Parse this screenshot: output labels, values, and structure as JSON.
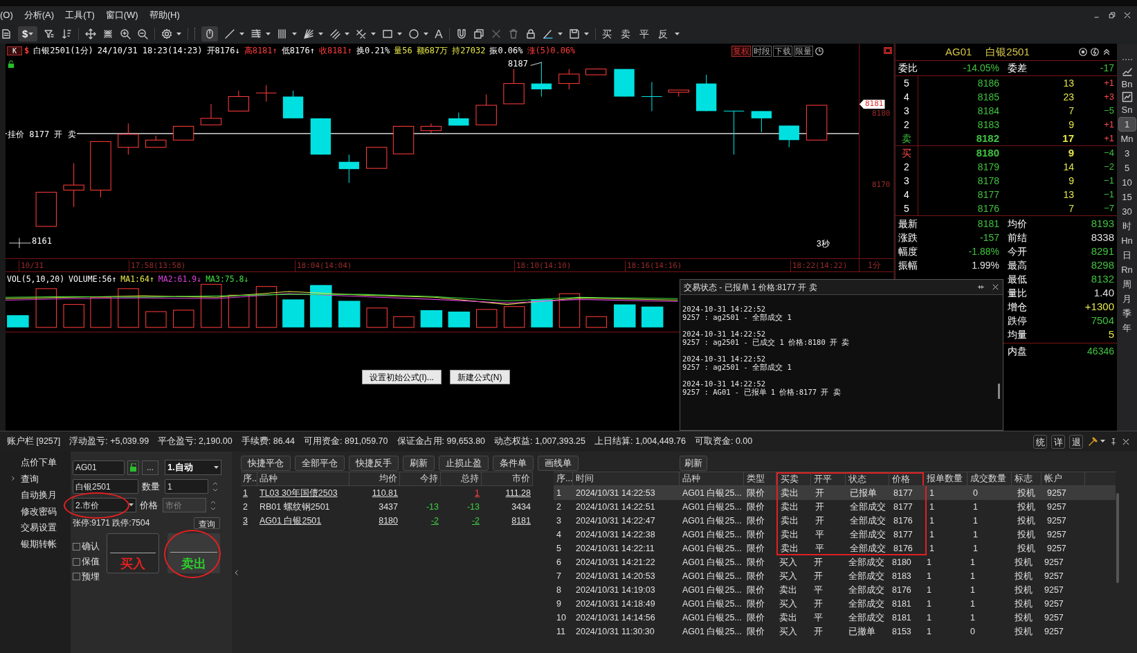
{
  "menu": [
    "(O)",
    "分析(A)",
    "工具(T)",
    "窗口(W)",
    "帮助(H)"
  ],
  "toolbar": {
    "currency": "$",
    "text_tool": "A",
    "trade_buttons": [
      "买",
      "卖",
      "平",
      "反"
    ]
  },
  "chart": {
    "badge": "K",
    "currency_mark": "$",
    "header": [
      {
        "text": "白银2501(1分)",
        "color": "#ffffff"
      },
      {
        "text": "24/10/31 18:23(14:23)",
        "color": "#ffffff"
      },
      {
        "text": "开8176↓",
        "color": "#ffffff"
      },
      {
        "text": "高8181↑",
        "color": "#ff3b3b"
      },
      {
        "text": "低8176↑",
        "color": "#ffffff"
      },
      {
        "text": "收8181↑",
        "color": "#ff3b3b"
      },
      {
        "text": "换0.21%",
        "color": "#ffffff"
      },
      {
        "text": "量56",
        "color": "#e8e84a"
      },
      {
        "text": "额687万",
        "color": "#e8e84a"
      },
      {
        "text": "持27032",
        "color": "#e8e84a"
      },
      {
        "text": "振0.06%",
        "color": "#ffffff"
      },
      {
        "text": "涨(5)0.06%",
        "color": "#ff3b3b"
      }
    ],
    "tools": [
      {
        "label": "复权",
        "selected": true
      },
      {
        "label": "时段",
        "selected": false
      },
      {
        "label": "下载",
        "selected": false
      },
      {
        "label": "限量",
        "selected": false
      }
    ],
    "order_line_label": "挂价 8177 开 卖",
    "high_label": "8187",
    "low_label": "8161",
    "countdown": "3秒",
    "price_axis": [
      {
        "text": "8181",
        "kind": "tag"
      },
      {
        "text": "8180",
        "kind": "plain"
      },
      {
        "text": "8170",
        "kind": "plain"
      }
    ],
    "time_axis": [
      "10/31",
      "17:58(13:58)",
      "18:04(14:04)",
      "18:10(14:10)",
      "18:16(14:16)",
      "18:22(14:22)"
    ],
    "period": "1分",
    "volume_legend": [
      {
        "text": "VOL(5,10,20)",
        "color": "#ffffff"
      },
      {
        "text": "VOLUME:56↑",
        "color": "#ffffff"
      },
      {
        "text": "MA1:64↑",
        "color": "#e8e84a"
      },
      {
        "text": "MA2:61.9↓",
        "color": "#e040e0"
      },
      {
        "text": "MA3:75.8↓",
        "color": "#40e040"
      }
    ],
    "formula_buttons": [
      "设置初始公式(I)...",
      "新建公式(N)"
    ]
  },
  "trade_status_popup": {
    "title": "交易状态 - 已报单 1 价格:8177 开 卖",
    "entries": [
      {
        "time": "2024-10-31 14:22:52",
        "message": "9257 : ag2501 - 全部成交 1"
      },
      {
        "time": "2024-10-31 14:22:52",
        "message": "9257 : ag2501 - 已成交 1 价格:8180 开 卖"
      },
      {
        "time": "2024-10-31 14:22:52",
        "message": "9257 : ag2501 - 全部成交 1"
      },
      {
        "time": "2024-10-31 14:22:52",
        "message": "9257 : AG01 - 已报单 1 价格:8177 开 卖"
      }
    ]
  },
  "quote": {
    "code": "AG01",
    "name": "白银2501",
    "ratio_label": "委比",
    "ratio": "-14.05%",
    "diff_label": "委差",
    "diff": "-17",
    "asks": [
      {
        "rank": "5",
        "price": "8186",
        "volume": "13",
        "change": "+1",
        "rising": true,
        "best": false
      },
      {
        "rank": "4",
        "price": "8185",
        "volume": "23",
        "change": "+3",
        "rising": true,
        "best": false
      },
      {
        "rank": "3",
        "price": "8184",
        "volume": "7",
        "change": "−5",
        "rising": false,
        "best": false
      },
      {
        "rank": "2",
        "price": "8183",
        "volume": "9",
        "change": "+1",
        "rising": true,
        "best": false
      },
      {
        "rank": "卖",
        "price": "8182",
        "volume": "17",
        "change": "+1",
        "rising": true,
        "best": true
      }
    ],
    "bids": [
      {
        "rank": "买",
        "price": "8180",
        "volume": "9",
        "change": "−4",
        "rising": false,
        "best": true
      },
      {
        "rank": "2",
        "price": "8179",
        "volume": "14",
        "change": "−2",
        "rising": false,
        "best": false
      },
      {
        "rank": "3",
        "price": "8178",
        "volume": "9",
        "change": "−1",
        "rising": false,
        "best": false
      },
      {
        "rank": "4",
        "price": "8177",
        "volume": "13",
        "change": "−1",
        "rising": false,
        "best": false
      },
      {
        "rank": "5",
        "price": "8176",
        "volume": "7",
        "change": "−7",
        "rising": false,
        "best": false
      }
    ],
    "stats_left": [
      {
        "label": "最新",
        "value": "8181",
        "color": "#3fc43f"
      },
      {
        "label": "涨跌",
        "value": "-157",
        "color": "#3fc43f"
      },
      {
        "label": "幅度",
        "value": "-1.88%",
        "color": "#3fc43f"
      },
      {
        "label": "振幅",
        "value": "1.99%",
        "color": "#e0e0e0"
      }
    ],
    "stats_right": [
      {
        "label": "均价",
        "value": "8193",
        "color": "#3fc43f"
      },
      {
        "label": "前结",
        "value": "8338",
        "color": "#e0e0e0"
      },
      {
        "label": "今开",
        "value": "8291",
        "color": "#3fc43f"
      },
      {
        "label": "最高",
        "value": "8298",
        "color": "#3fc43f"
      },
      {
        "label": "最低",
        "value": "8132",
        "color": "#3fc43f"
      },
      {
        "label": "量比",
        "value": "1.40",
        "color": "#e0e0e0"
      },
      {
        "label": "增仓",
        "value": "+1300",
        "color": "#e8e84a"
      },
      {
        "label": "跌停",
        "value": "7504",
        "color": "#3fc43f"
      },
      {
        "label": "均量",
        "value": "5",
        "color": "#e8e84a"
      }
    ],
    "footer": {
      "label": "内盘",
      "value": "46346"
    }
  },
  "period_bar": [
    {
      "label": "Bn",
      "selected": false
    },
    {
      "label": "Sn",
      "selected": false
    },
    {
      "label": "1",
      "selected": true
    },
    {
      "label": "Mn",
      "selected": false
    },
    {
      "label": "3",
      "selected": false
    },
    {
      "label": "5",
      "selected": false
    },
    {
      "label": "10",
      "selected": false
    },
    {
      "label": "15",
      "selected": false
    },
    {
      "label": "30",
      "selected": false
    },
    {
      "label": "时",
      "selected": false
    },
    {
      "label": "Hn",
      "selected": false
    },
    {
      "label": "日",
      "selected": false
    },
    {
      "label": "Rn",
      "selected": false
    },
    {
      "label": "周",
      "selected": false
    },
    {
      "label": "月",
      "selected": false
    },
    {
      "label": "季",
      "selected": false
    },
    {
      "label": "年",
      "selected": false
    }
  ],
  "account": {
    "fields": [
      "账户栏 [9257]",
      "浮动盈亏: +5,039.99",
      "平仓盈亏: 2,190.00",
      "手续费: 86.44",
      "可用资金: 891,059.70",
      "保证金占用: 99,653.80",
      "动态权益: 1,007,393.25",
      "上日结算: 1,004,449.76",
      "可取资金: 0.00"
    ],
    "buttons": [
      "统",
      "详",
      "退"
    ]
  },
  "nav": [
    {
      "label": "点价下单",
      "expandable": false
    },
    {
      "label": "查询",
      "expandable": true
    },
    {
      "label": "自动换月",
      "expandable": false
    },
    {
      "label": "修改密码",
      "expandable": false
    },
    {
      "label": "交易设置",
      "expandable": false
    },
    {
      "label": "银期转帐",
      "expandable": false
    }
  ],
  "order_form": {
    "code": "AG01",
    "more": "...",
    "mode": "1.自动",
    "name": "白银2501",
    "qty_label": "数量",
    "qty": "1",
    "price_type": "2.市价",
    "price_type_circled": true,
    "price_label": "价格",
    "price_placeholder": "市价",
    "limits": "张停:9171 跌停:7504",
    "query": "查询",
    "options": [
      {
        "label": "确认",
        "checked": false
      },
      {
        "label": "保值",
        "checked": false
      },
      {
        "label": "预埋",
        "checked": false
      }
    ],
    "buy": "买入",
    "sell": "卖出",
    "sell_circled": true
  },
  "positions": {
    "buttons": [
      "快捷平仓",
      "全部平仓",
      "快捷反手",
      "刷新",
      "止损止盈",
      "条件单",
      "画线单"
    ],
    "columns": [
      "序..",
      "品种",
      "均价",
      "今持",
      "总持",
      "市价"
    ],
    "rows": [
      {
        "no": "1",
        "name": "TL03 30年国债2503",
        "avg": "110.81",
        "total": "1",
        "market": "111.28",
        "linked": true,
        "long": true
      },
      {
        "no": "2",
        "name": "RB01 螺纹钢2501",
        "avg": "3437",
        "today": "-13",
        "total": "-13",
        "market": "3434",
        "linked": false,
        "long": false
      },
      {
        "no": "3",
        "name": "AG01 白银2501",
        "avg": "8180",
        "today": "-2",
        "total": "-2",
        "market": "8181",
        "linked": true,
        "long": false
      }
    ]
  },
  "orders": {
    "refresh": "刷新",
    "columns": [
      {
        "label": "序...",
        "highlighted": false
      },
      {
        "label": "时间",
        "highlighted": false
      },
      {
        "label": "品种",
        "highlighted": false
      },
      {
        "label": "类型",
        "highlighted": false
      },
      {
        "label": "买卖",
        "highlighted": true
      },
      {
        "label": "开平",
        "highlighted": true
      },
      {
        "label": "状态",
        "highlighted": true
      },
      {
        "label": "价格",
        "highlighted": true
      },
      {
        "label": "报单数量",
        "highlighted": false
      },
      {
        "label": "成交数量",
        "highlighted": false
      },
      {
        "label": "标志",
        "highlighted": false
      },
      {
        "label": "帐户",
        "highlighted": false
      }
    ],
    "rows": [
      {
        "cells": [
          "1",
          "2024/10/31 14:22:53",
          "AG01 白银25...",
          "限价",
          "卖出",
          "开",
          "已报单",
          "8177",
          "1",
          "0",
          "投机",
          "9257"
        ],
        "selected": true,
        "highlighted": true
      },
      {
        "cells": [
          "2",
          "2024/10/31 14:22:51",
          "AG01 白银25...",
          "限价",
          "卖出",
          "开",
          "全部成交",
          "8177",
          "1",
          "1",
          "投机",
          "9257"
        ],
        "selected": false,
        "highlighted": true
      },
      {
        "cells": [
          "3",
          "2024/10/31 14:22:47",
          "AG01 白银25...",
          "限价",
          "卖出",
          "开",
          "全部成交",
          "8176",
          "1",
          "1",
          "投机",
          "9257"
        ],
        "selected": false,
        "highlighted": true
      },
      {
        "cells": [
          "4",
          "2024/10/31 14:22:38",
          "AG01 白银25...",
          "限价",
          "卖出",
          "平",
          "全部成交",
          "8177",
          "1",
          "1",
          "投机",
          "9257"
        ],
        "selected": false,
        "highlighted": true
      },
      {
        "cells": [
          "5",
          "2024/10/31 14:22:11",
          "AG01 白银25...",
          "限价",
          "卖出",
          "平",
          "全部成交",
          "8176",
          "1",
          "1",
          "投机",
          "9257"
        ],
        "selected": false,
        "highlighted": true
      },
      {
        "cells": [
          "6",
          "2024/10/31 14:21:22",
          "AG01 白银25...",
          "限价",
          "买入",
          "开",
          "全部成交",
          "8180",
          "1",
          "1",
          "投机",
          "9257"
        ],
        "selected": false,
        "highlighted": false
      },
      {
        "cells": [
          "7",
          "2024/10/31 14:20:53",
          "AG01 白银25...",
          "限价",
          "买入",
          "开",
          "全部成交",
          "8183",
          "1",
          "1",
          "投机",
          "9257"
        ],
        "selected": false,
        "highlighted": false
      },
      {
        "cells": [
          "8",
          "2024/10/31 14:19:03",
          "AG01 白银25...",
          "限价",
          "卖出",
          "平",
          "全部成交",
          "8176",
          "1",
          "1",
          "投机",
          "9257"
        ],
        "selected": false,
        "highlighted": false
      },
      {
        "cells": [
          "9",
          "2024/10/31 14:18:49",
          "AG01 白银25...",
          "限价",
          "买入",
          "开",
          "全部成交",
          "8181",
          "1",
          "1",
          "投机",
          "9257"
        ],
        "selected": false,
        "highlighted": false
      },
      {
        "cells": [
          "10",
          "2024/10/31 14:14:56",
          "AG01 白银25...",
          "限价",
          "卖出",
          "平",
          "全部成交",
          "8181",
          "1",
          "1",
          "投机",
          "9257"
        ],
        "selected": false,
        "highlighted": false
      },
      {
        "cells": [
          "11",
          "2024/10/31 11:30:30",
          "AG01 白银25...",
          "限价",
          "买入",
          "开",
          "已撤单",
          "8153",
          "1",
          "0",
          "投机",
          "9257"
        ],
        "selected": false,
        "highlighted": false
      }
    ]
  }
}
